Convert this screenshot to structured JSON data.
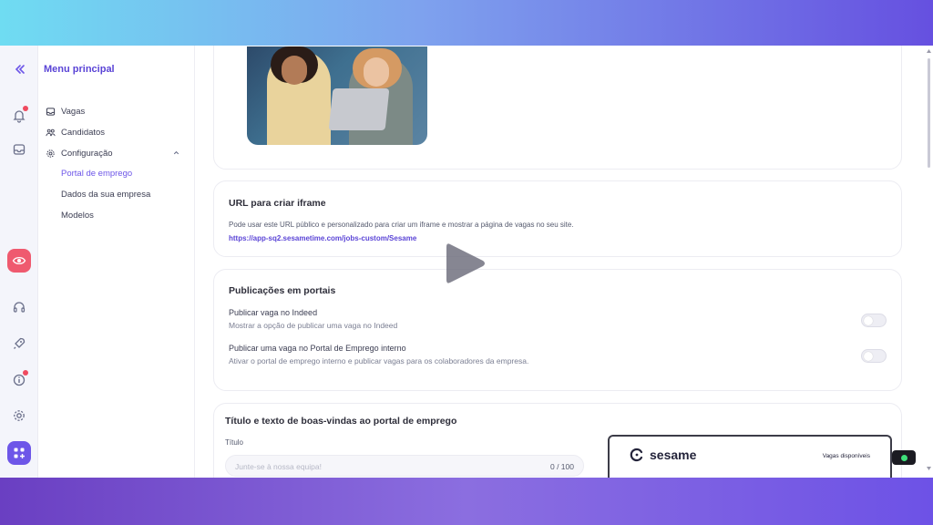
{
  "menu": {
    "title": "Menu principal",
    "items": [
      {
        "label": "Vagas",
        "icon": "inbox-icon"
      },
      {
        "label": "Candidatos",
        "icon": "people-icon"
      },
      {
        "label": "Configuração",
        "icon": "gear-icon"
      }
    ],
    "subitems": [
      {
        "label": "Portal de emprego",
        "active": true
      },
      {
        "label": "Dados da sua empresa",
        "active": false
      },
      {
        "label": "Modelos",
        "active": false
      }
    ]
  },
  "iframe_card": {
    "title": "URL para criar iframe",
    "description": "Pode usar este URL público e personalizado para criar um iframe e mostrar a página de vagas no seu site.",
    "url": "https://app-sq2.sesametime.com/jobs-custom/Sesame"
  },
  "portals_card": {
    "title": "Publicações em portais",
    "rows": [
      {
        "title": "Publicar vaga no Indeed",
        "description": "Mostrar a opção de publicar uma vaga no Indeed",
        "enabled": false
      },
      {
        "title": "Publicar uma vaga no Portal de Emprego interno",
        "description": "Ativar o portal de emprego interno e publicar vagas para os colaboradores da empresa.",
        "enabled": false
      }
    ]
  },
  "welcome_card": {
    "title": "Título e texto de boas-vindas ao portal de emprego",
    "field_label": "Título",
    "placeholder": "Junte-se à nossa equipa!",
    "counter": "0 / 100"
  },
  "preview": {
    "brand": "sesame",
    "nav_label": "Vagas disponíveis"
  },
  "colors": {
    "accent": "#6d56e8",
    "alert": "#ef5a6f"
  }
}
